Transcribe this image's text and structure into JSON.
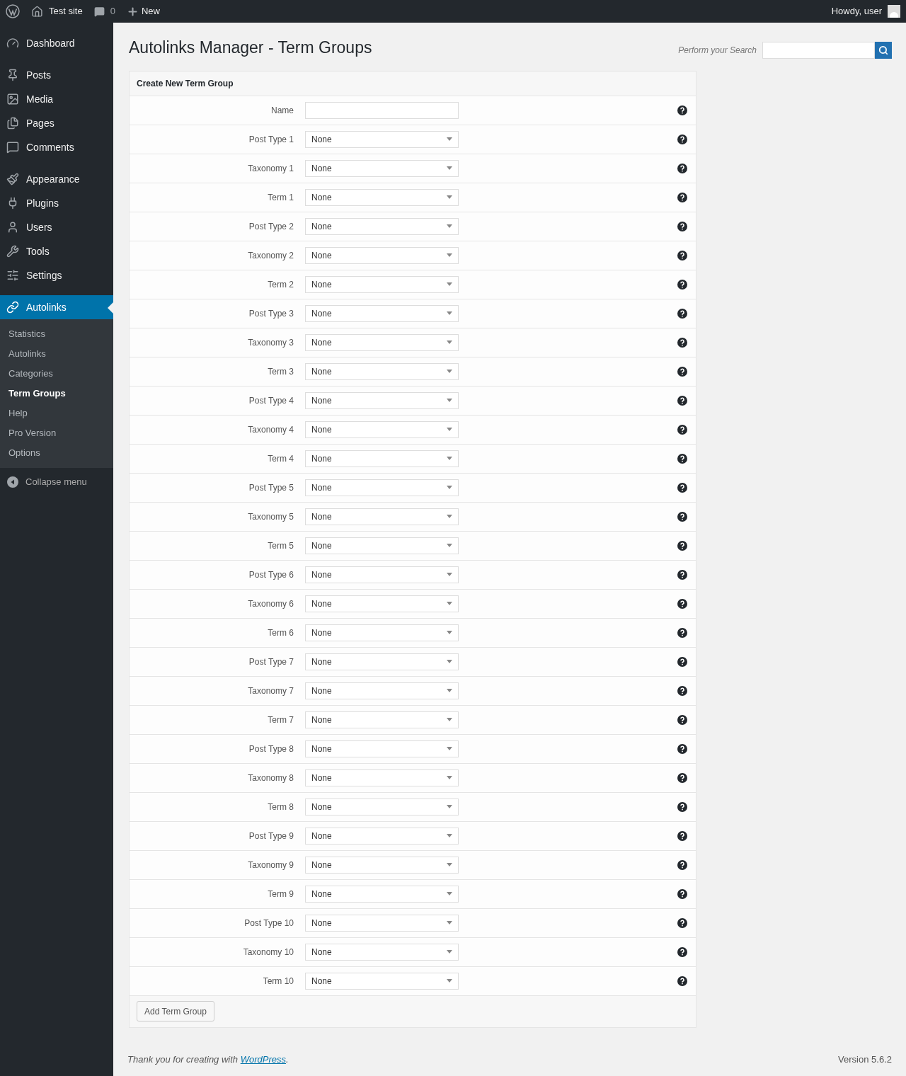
{
  "admin_bar": {
    "site": "Test site",
    "comments": "0",
    "new": "New",
    "greeting": "Howdy, user"
  },
  "menu_groups": [
    [
      {
        "label": "Dashboard",
        "selected": false
      }
    ],
    [
      {
        "label": "Posts",
        "selected": false
      },
      {
        "label": "Media",
        "selected": false
      },
      {
        "label": "Pages",
        "selected": false
      },
      {
        "label": "Comments",
        "selected": false
      }
    ],
    [
      {
        "label": "Appearance",
        "selected": false
      },
      {
        "label": "Plugins",
        "selected": false
      },
      {
        "label": "Users",
        "selected": false
      },
      {
        "label": "Tools",
        "selected": false
      },
      {
        "label": "Settings",
        "selected": false
      }
    ],
    [
      {
        "label": "Autolinks",
        "selected": true
      }
    ]
  ],
  "submenu": [
    {
      "label": "Statistics",
      "selected": false
    },
    {
      "label": "Autolinks",
      "selected": false
    },
    {
      "label": "Categories",
      "selected": false
    },
    {
      "label": "Term Groups",
      "selected": true
    },
    {
      "label": "Help",
      "selected": false
    },
    {
      "label": "Pro Version",
      "selected": false
    },
    {
      "label": "Options",
      "selected": false
    }
  ],
  "collapse": "Collapse menu",
  "page_title": "Autolinks Manager - Term Groups",
  "search": {
    "label": "Perform your Search"
  },
  "form": {
    "title": "Create New Term Group",
    "fields": [
      {
        "kind": "text",
        "label": "Name"
      },
      {
        "kind": "select",
        "label": "Post Type 1",
        "value": "None"
      },
      {
        "kind": "select",
        "label": "Taxonomy 1",
        "value": "None"
      },
      {
        "kind": "select",
        "label": "Term 1",
        "value": "None"
      },
      {
        "kind": "select",
        "label": "Post Type 2",
        "value": "None"
      },
      {
        "kind": "select",
        "label": "Taxonomy 2",
        "value": "None"
      },
      {
        "kind": "select",
        "label": "Term 2",
        "value": "None"
      },
      {
        "kind": "select",
        "label": "Post Type 3",
        "value": "None"
      },
      {
        "kind": "select",
        "label": "Taxonomy 3",
        "value": "None"
      },
      {
        "kind": "select",
        "label": "Term 3",
        "value": "None"
      },
      {
        "kind": "select",
        "label": "Post Type 4",
        "value": "None"
      },
      {
        "kind": "select",
        "label": "Taxonomy 4",
        "value": "None"
      },
      {
        "kind": "select",
        "label": "Term 4",
        "value": "None"
      },
      {
        "kind": "select",
        "label": "Post Type 5",
        "value": "None"
      },
      {
        "kind": "select",
        "label": "Taxonomy 5",
        "value": "None"
      },
      {
        "kind": "select",
        "label": "Term 5",
        "value": "None"
      },
      {
        "kind": "select",
        "label": "Post Type 6",
        "value": "None"
      },
      {
        "kind": "select",
        "label": "Taxonomy 6",
        "value": "None"
      },
      {
        "kind": "select",
        "label": "Term 6",
        "value": "None"
      },
      {
        "kind": "select",
        "label": "Post Type 7",
        "value": "None"
      },
      {
        "kind": "select",
        "label": "Taxonomy 7",
        "value": "None"
      },
      {
        "kind": "select",
        "label": "Term 7",
        "value": "None"
      },
      {
        "kind": "select",
        "label": "Post Type 8",
        "value": "None"
      },
      {
        "kind": "select",
        "label": "Taxonomy 8",
        "value": "None"
      },
      {
        "kind": "select",
        "label": "Term 8",
        "value": "None"
      },
      {
        "kind": "select",
        "label": "Post Type 9",
        "value": "None"
      },
      {
        "kind": "select",
        "label": "Taxonomy 9",
        "value": "None"
      },
      {
        "kind": "select",
        "label": "Term 9",
        "value": "None"
      },
      {
        "kind": "select",
        "label": "Post Type 10",
        "value": "None"
      },
      {
        "kind": "select",
        "label": "Taxonomy 10",
        "value": "None"
      },
      {
        "kind": "select",
        "label": "Term 10",
        "value": "None"
      }
    ],
    "submit": "Add Term Group"
  },
  "footer": {
    "text": "Thank you for creating with",
    "link": "WordPress",
    "after": ".",
    "version": "Version 5.6.2"
  }
}
